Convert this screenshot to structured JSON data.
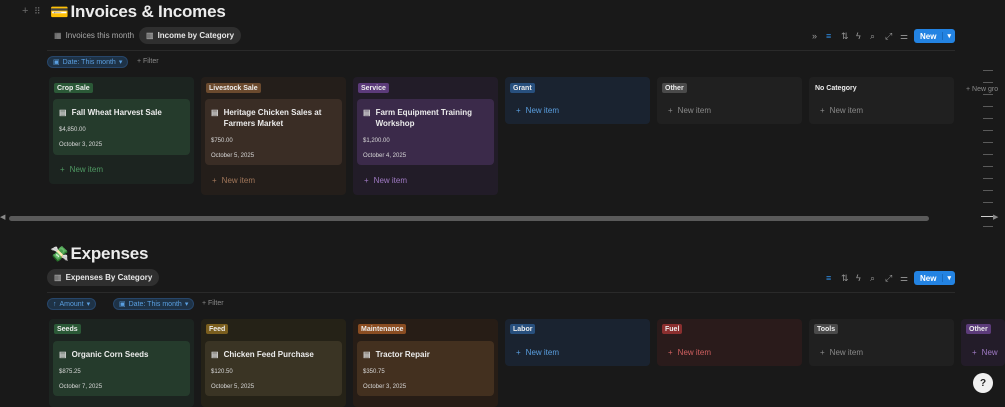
{
  "invoices": {
    "title": "Invoices & Incomes",
    "emoji": "💳",
    "tabs": [
      {
        "label": "Invoices this month"
      },
      {
        "label": "Income by Category"
      }
    ],
    "toolbar": {
      "new_label": "New"
    },
    "filters": {
      "date_pill": "Date: This month",
      "add_filter": "+ Filter"
    },
    "columns": [
      {
        "tag": "Crop Sale",
        "new_item": "New item",
        "card": {
          "title": "Fall Wheat Harvest Sale",
          "amount": "$4,850.00",
          "date": "October 3, 2025"
        }
      },
      {
        "tag": "Livestock Sale",
        "new_item": "New item",
        "card": {
          "title": "Heritage Chicken Sales at Farmers Market",
          "amount": "$750.00",
          "date": "October 5, 2025"
        }
      },
      {
        "tag": "Service",
        "new_item": "New item",
        "card": {
          "title": "Farm Equipment Training Workshop",
          "amount": "$1,200.00",
          "date": "October 4, 2025"
        }
      },
      {
        "tag": "Grant",
        "new_item": "New item"
      },
      {
        "tag": "Other",
        "new_item": "New item"
      },
      {
        "tag": "No Category",
        "new_item": "New item"
      }
    ],
    "new_group": "+ New gro"
  },
  "expenses": {
    "title": "Expenses",
    "emoji": "💸",
    "tabs": [
      {
        "label": "Expenses By Category"
      }
    ],
    "toolbar": {
      "new_label": "New"
    },
    "filters": {
      "amount_pill": "Amount",
      "date_pill": "Date: This month",
      "add_filter": "+ Filter"
    },
    "columns": [
      {
        "tag": "Seeds",
        "card": {
          "title": "Organic Corn Seeds",
          "amount": "$875.25",
          "date": "October 7, 2025"
        }
      },
      {
        "tag": "Feed",
        "card": {
          "title": "Chicken Feed Purchase",
          "amount": "$120.50",
          "date": "October 5, 2025"
        }
      },
      {
        "tag": "Maintenance",
        "card": {
          "title": "Tractor Repair",
          "amount": "$350.75",
          "date": "October 3, 2025"
        }
      },
      {
        "tag": "Labor",
        "new_item": "New item"
      },
      {
        "tag": "Fuel",
        "new_item": "New item"
      },
      {
        "tag": "Tools",
        "new_item": "New item"
      },
      {
        "tag": "Other",
        "new_item": "New"
      }
    ]
  },
  "colors": {
    "accent": "#2383e2",
    "bg": "#191919"
  }
}
